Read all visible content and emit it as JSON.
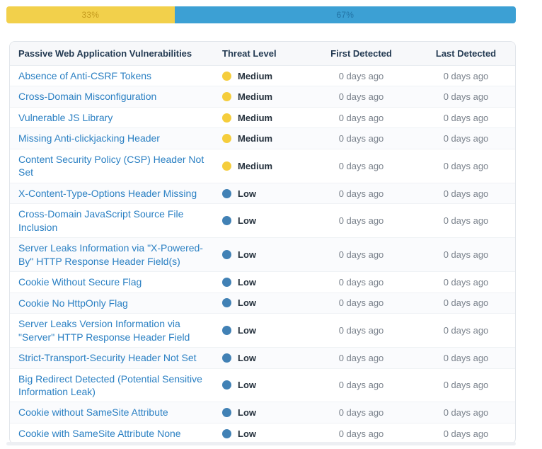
{
  "progress": {
    "segments": [
      {
        "name": "medium",
        "label": "33%",
        "percent": 33,
        "color": "#F2D04B",
        "text_color": "#C59B1E"
      },
      {
        "name": "low",
        "label": "67%",
        "percent": 67,
        "color": "#3CA0D4",
        "text_color": "#2273A5"
      }
    ]
  },
  "table": {
    "headers": {
      "name": "Passive Web Application Vulnerabilities",
      "threat": "Threat Level",
      "first": "First Detected",
      "last": "Last Detected"
    },
    "rows": [
      {
        "name": "Absence of Anti-CSRF Tokens",
        "threat": "Medium",
        "severity": "medium",
        "first": "0 days ago",
        "last": "0 days ago"
      },
      {
        "name": "Cross-Domain Misconfiguration",
        "threat": "Medium",
        "severity": "medium",
        "first": "0 days ago",
        "last": "0 days ago"
      },
      {
        "name": "Vulnerable JS Library",
        "threat": "Medium",
        "severity": "medium",
        "first": "0 days ago",
        "last": "0 days ago"
      },
      {
        "name": "Missing Anti-clickjacking Header",
        "threat": "Medium",
        "severity": "medium",
        "first": "0 days ago",
        "last": "0 days ago"
      },
      {
        "name": "Content Security Policy (CSP) Header Not Set",
        "threat": "Medium",
        "severity": "medium",
        "first": "0 days ago",
        "last": "0 days ago"
      },
      {
        "name": "X-Content-Type-Options Header Missing",
        "threat": "Low",
        "severity": "low",
        "first": "0 days ago",
        "last": "0 days ago"
      },
      {
        "name": "Cross-Domain JavaScript Source File Inclusion",
        "threat": "Low",
        "severity": "low",
        "first": "0 days ago",
        "last": "0 days ago"
      },
      {
        "name": "Server Leaks Information via \"X-Powered-By\" HTTP Response Header Field(s)",
        "threat": "Low",
        "severity": "low",
        "first": "0 days ago",
        "last": "0 days ago"
      },
      {
        "name": "Cookie Without Secure Flag",
        "threat": "Low",
        "severity": "low",
        "first": "0 days ago",
        "last": "0 days ago"
      },
      {
        "name": "Cookie No HttpOnly Flag",
        "threat": "Low",
        "severity": "low",
        "first": "0 days ago",
        "last": "0 days ago"
      },
      {
        "name": "Server Leaks Version Information via \"Server\" HTTP Response Header Field",
        "threat": "Low",
        "severity": "low",
        "first": "0 days ago",
        "last": "0 days ago"
      },
      {
        "name": "Strict-Transport-Security Header Not Set",
        "threat": "Low",
        "severity": "low",
        "first": "0 days ago",
        "last": "0 days ago"
      },
      {
        "name": "Big Redirect Detected (Potential Sensitive Information Leak)",
        "threat": "Low",
        "severity": "low",
        "first": "0 days ago",
        "last": "0 days ago"
      },
      {
        "name": "Cookie without SameSite Attribute",
        "threat": "Low",
        "severity": "low",
        "first": "0 days ago",
        "last": "0 days ago"
      },
      {
        "name": "Cookie with SameSite Attribute None",
        "threat": "Low",
        "severity": "low",
        "first": "0 days ago",
        "last": "0 days ago"
      }
    ]
  },
  "colors": {
    "medium": "#F5CD3C",
    "low": "#4181B5"
  }
}
